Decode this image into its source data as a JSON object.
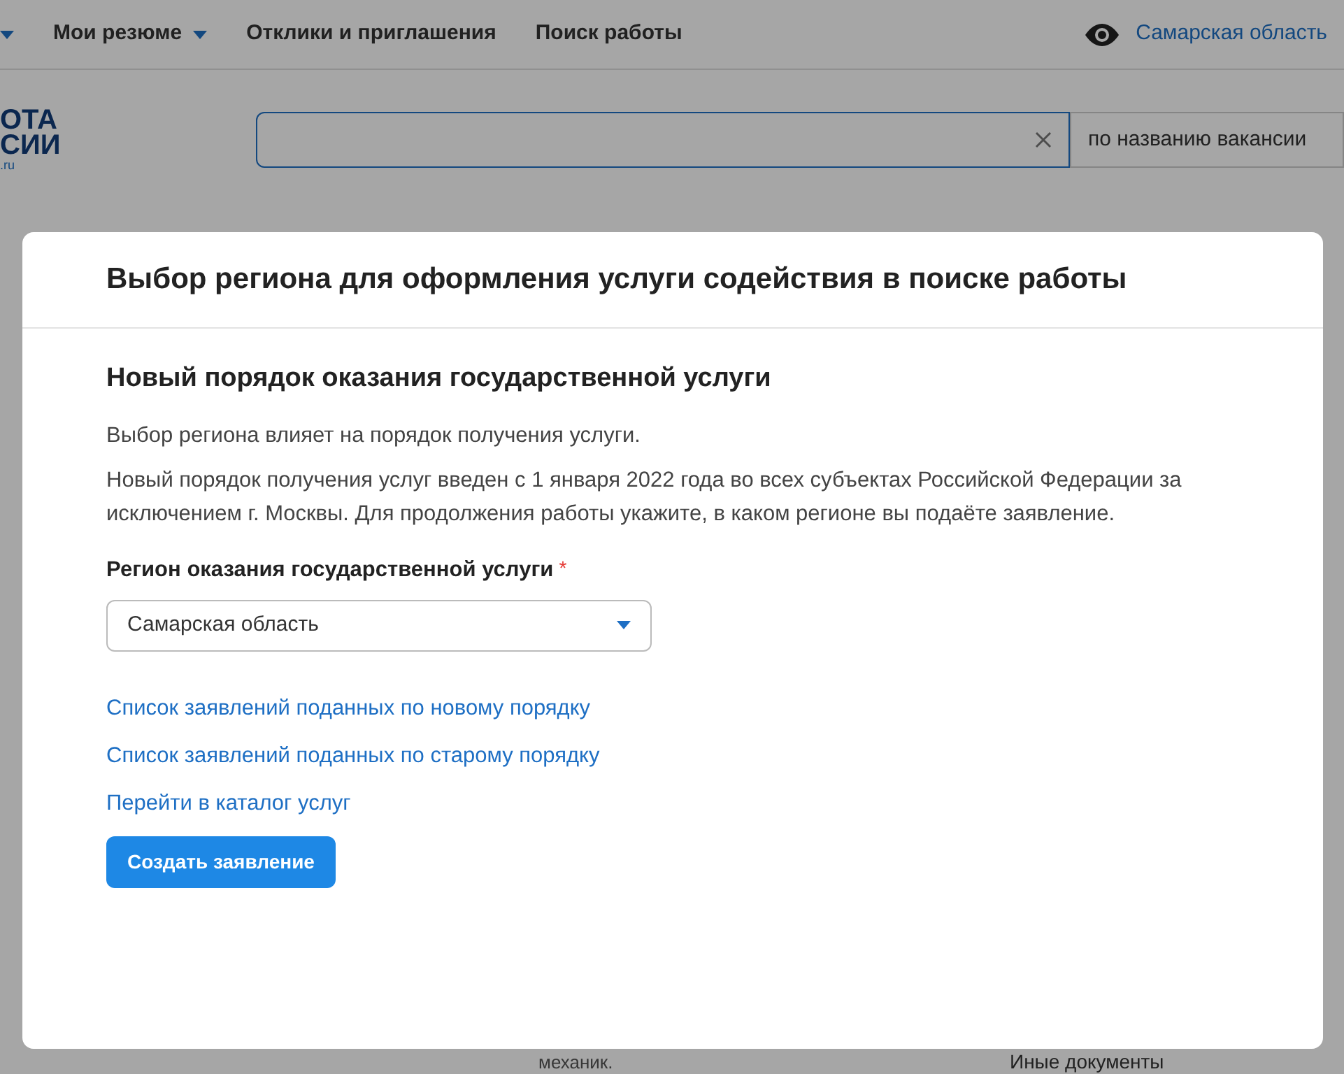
{
  "nav": {
    "items": [
      {
        "dropdown": true
      },
      {
        "label": "Мои резюме",
        "dropdown": true
      },
      {
        "label": "Отклики и приглашения",
        "dropdown": false
      },
      {
        "label": "Поиск работы",
        "dropdown": false
      }
    ],
    "region": "Самарская область"
  },
  "logo": {
    "lines": [
      "ОТА",
      "СИИ"
    ],
    "domain": ".ru"
  },
  "search": {
    "scope": "по названию вакансии"
  },
  "background": {
    "bottom_text": "механик.",
    "side_text": "Иные документы"
  },
  "modal": {
    "title": "Выбор региона для оформления услуги содействия в поиске работы",
    "section_title": "Новый порядок оказания государственной услуги",
    "paragraphs": [
      "Выбор региона влияет на порядок получения услуги.",
      "Новый порядок получения услуг введен с 1 января 2022 года во всех субъектах Российской Федерации за исключением г. Москвы. Для продолжения работы укажите, в каком регионе вы подаёте заявление."
    ],
    "field": {
      "label": "Регион оказания государственной услуги",
      "required": true,
      "required_mark": "*",
      "value": "Самарская область"
    },
    "links": [
      "Список заявлений поданных по новому порядку",
      "Список заявлений поданных по старому порядку",
      "Перейти в каталог услуг"
    ],
    "button": "Создать заявление"
  }
}
